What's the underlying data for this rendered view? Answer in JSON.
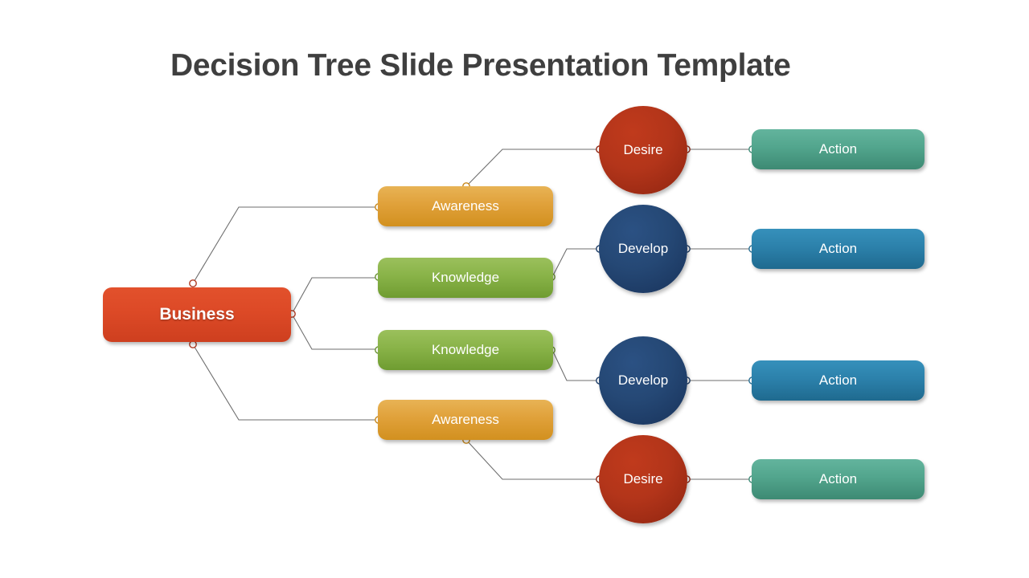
{
  "slide": {
    "title": "Decision Tree Slide Presentation Template",
    "background_color": "#ffffff",
    "title_color": "#3f3f3f"
  },
  "diagram": {
    "type": "decision-tree",
    "root": {
      "label": "Business",
      "color": "#dd4a27",
      "shape": "rounded-rectangle"
    },
    "branches": [
      {
        "middle": {
          "label": "Awareness",
          "color": "#e0a13a",
          "shape": "rounded-rectangle"
        },
        "circle": {
          "label": "Desire",
          "color": "#b3351a",
          "shape": "circle"
        },
        "action": {
          "label": "Action",
          "color": "#52a58d",
          "shape": "rounded-rectangle"
        }
      },
      {
        "middle": {
          "label": "Knowledge",
          "color": "#89b348",
          "shape": "rounded-rectangle"
        },
        "circle": {
          "label": "Develop",
          "color": "#254875",
          "shape": "circle"
        },
        "action": {
          "label": "Action",
          "color": "#2c81ab",
          "shape": "rounded-rectangle"
        }
      },
      {
        "middle": {
          "label": "Knowledge",
          "color": "#89b348",
          "shape": "rounded-rectangle"
        },
        "circle": {
          "label": "Develop",
          "color": "#254875",
          "shape": "circle"
        },
        "action": {
          "label": "Action",
          "color": "#2c81ab",
          "shape": "rounded-rectangle"
        }
      },
      {
        "middle": {
          "label": "Awareness",
          "color": "#e0a13a",
          "shape": "rounded-rectangle"
        },
        "circle": {
          "label": "Desire",
          "color": "#b3351a",
          "shape": "circle"
        },
        "action": {
          "label": "Action",
          "color": "#52a58d",
          "shape": "rounded-rectangle"
        }
      }
    ],
    "connector_color": "#6e6e6e"
  }
}
